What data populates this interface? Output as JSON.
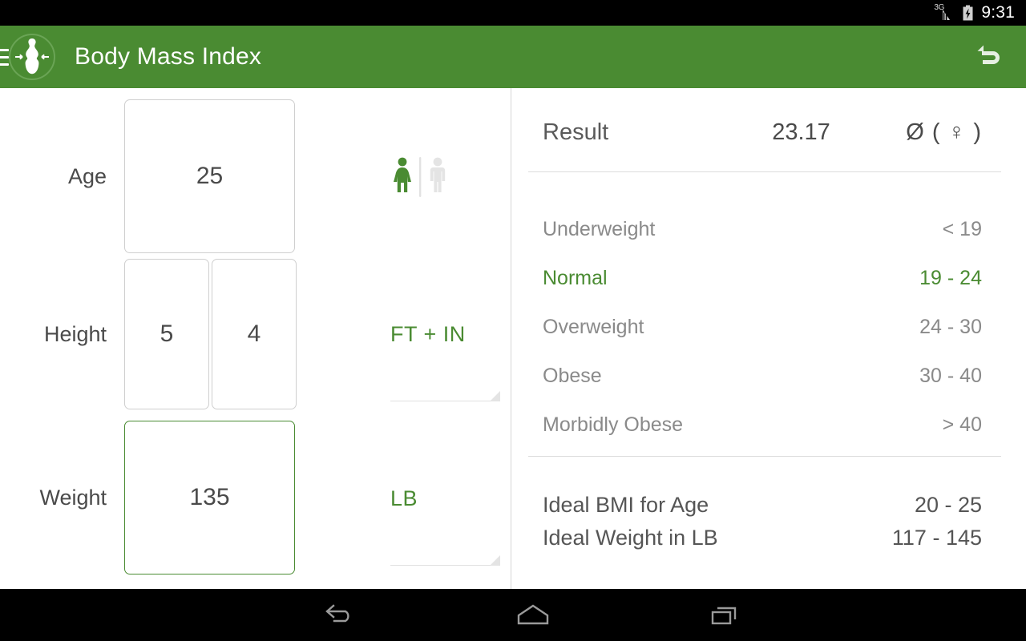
{
  "statusbar": {
    "network_label": "3G",
    "signal_icon": "signal-bars-icon",
    "battery_icon": "battery-charging-icon",
    "time": "9:31"
  },
  "appbar": {
    "menu_icon": "hamburger-menu-icon",
    "logo_icon": "mannequin-waist-icon",
    "title": "Body Mass Index",
    "reset_icon": "undo-arrow-icon",
    "background_color": "#4a8b32"
  },
  "form": {
    "age": {
      "label": "Age",
      "value": "25"
    },
    "height": {
      "label": "Height",
      "feet": "5",
      "inches": "4",
      "unit": "FT + IN"
    },
    "weight": {
      "label": "Weight",
      "value": "135",
      "unit": "LB",
      "focused": true
    },
    "gender": {
      "female_icon": "female-figure-icon",
      "male_icon": "male-figure-icon",
      "selected": "female"
    }
  },
  "results": {
    "result_label": "Result",
    "result_value": "23.17",
    "average_label": "Ø ( ♀ )",
    "categories": [
      {
        "name": "Underweight",
        "range": "< 19",
        "active": false
      },
      {
        "name": "Normal",
        "range": "19 - 24",
        "active": true
      },
      {
        "name": "Overweight",
        "range": "24 - 30",
        "active": false
      },
      {
        "name": "Obese",
        "range": "30 - 40",
        "active": false
      },
      {
        "name": "Morbidly Obese",
        "range": "> 40",
        "active": false
      }
    ],
    "ideal": [
      {
        "name": "Ideal BMI for Age",
        "value": "20 - 25"
      },
      {
        "name": "Ideal Weight in LB",
        "value": "117 - 145"
      }
    ]
  },
  "navbar": {
    "back_icon": "back-arrow-icon",
    "home_icon": "home-icon",
    "recents_icon": "recent-apps-icon"
  },
  "colors": {
    "accent_green": "#4a8b32",
    "text_dark": "#4a4a4a",
    "text_muted": "#8a8a8a"
  }
}
